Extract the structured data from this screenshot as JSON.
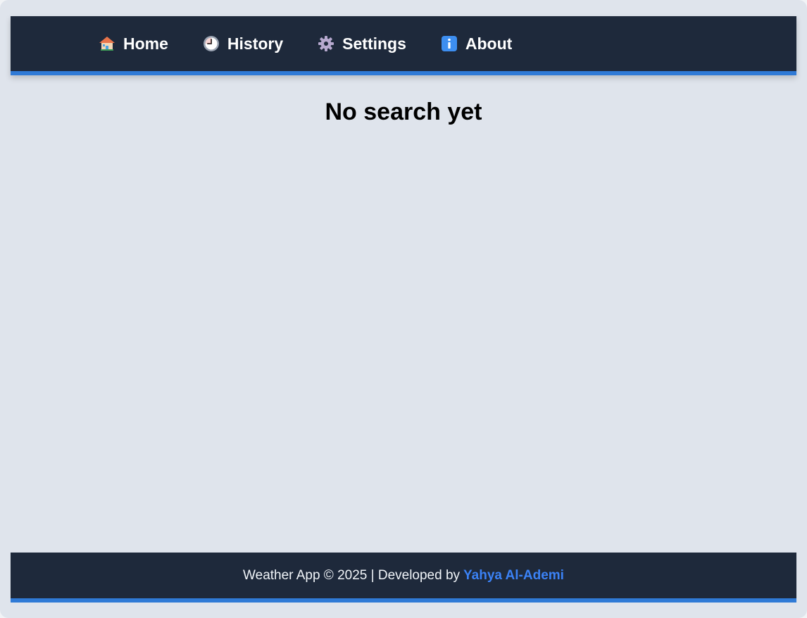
{
  "nav": {
    "items": [
      {
        "label": "Home",
        "icon": "house-icon"
      },
      {
        "label": "History",
        "icon": "clock-icon"
      },
      {
        "label": "Settings",
        "icon": "gear-icon"
      },
      {
        "label": "About",
        "icon": "info-icon"
      }
    ]
  },
  "main": {
    "title": "No search yet"
  },
  "footer": {
    "text": "Weather App © 2025 | Developed by",
    "author": "Yahya Al-Ademi"
  },
  "colors": {
    "nav_background": "#1e293b",
    "accent": "#2f7ad6",
    "page_background": "#dfe4ec",
    "author_link": "#3b82f6"
  }
}
